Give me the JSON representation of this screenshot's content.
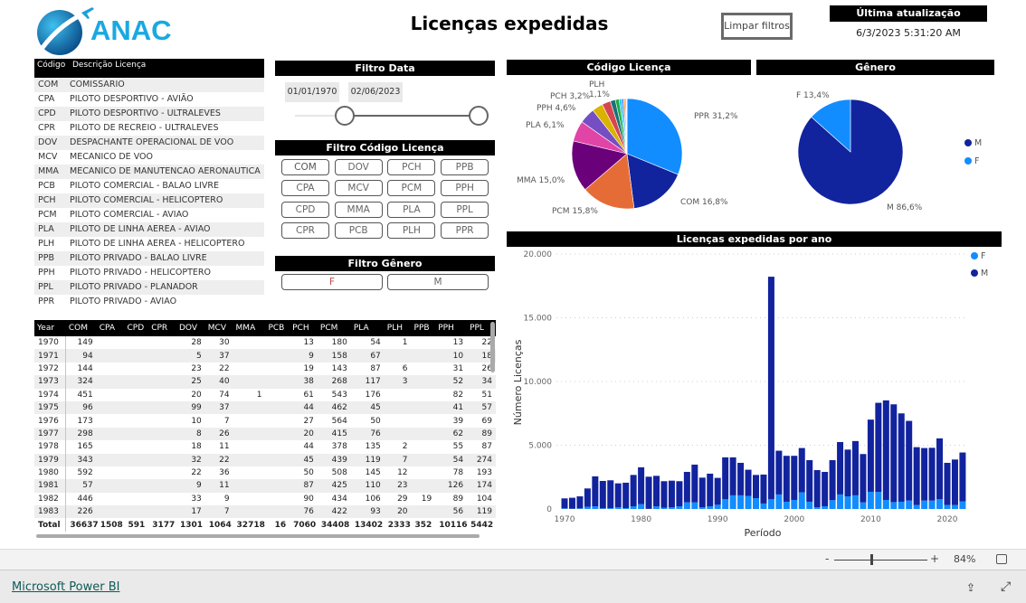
{
  "header": {
    "logo_text": "ANAC",
    "title": "Licenças expedidas",
    "clear_filters": "Limpar filtros",
    "last_update_label": "Última atualização",
    "last_update_value": "6/3/2023 5:31:20 AM"
  },
  "license_list": {
    "col_code": "Código",
    "col_desc": "Descrição Licença",
    "items": [
      [
        "COM",
        "COMISSARIO"
      ],
      [
        "CPA",
        "PILOTO DESPORTIVO - AVIÃO"
      ],
      [
        "CPD",
        "PILOTO DESPORTIVO - ULTRALEVES"
      ],
      [
        "CPR",
        "PILOTO DE RECREIO - ULTRALEVES"
      ],
      [
        "DOV",
        "DESPACHANTE OPERACIONAL DE VOO"
      ],
      [
        "MCV",
        "MECANICO DE VOO"
      ],
      [
        "MMA",
        "MECANICO DE MANUTENCAO AERONAUTICA"
      ],
      [
        "PCB",
        "PILOTO COMERCIAL - BALAO LIVRE"
      ],
      [
        "PCH",
        "PILOTO COMERCIAL - HELICOPTERO"
      ],
      [
        "PCM",
        "PILOTO COMERCIAL - AVIAO"
      ],
      [
        "PLA",
        "PILOTO DE LINHA AEREA - AVIAO"
      ],
      [
        "PLH",
        "PILOTO DE LINHA AEREA - HELICOPTERO"
      ],
      [
        "PPB",
        "PILOTO PRIVADO - BALAO LIVRE"
      ],
      [
        "PPH",
        "PILOTO PRIVADO - HELICOPTERO"
      ],
      [
        "PPL",
        "PILOTO PRIVADO - PLANADOR"
      ],
      [
        "PPR",
        "PILOTO PRIVADO - AVIAO"
      ]
    ]
  },
  "filter_date": {
    "title": "Filtro Data",
    "start": "01/01/1970",
    "end": "02/06/2023"
  },
  "filter_code": {
    "title": "Filtro Código Licença",
    "buttons": [
      "COM",
      "DOV",
      "PCH",
      "PPB",
      "CPA",
      "MCV",
      "PCM",
      "PPH",
      "CPD",
      "MMA",
      "PLA",
      "PPL",
      "CPR",
      "PCB",
      "PLH",
      "PPR"
    ]
  },
  "filter_gender": {
    "title": "Filtro Gênero",
    "buttons": [
      "F",
      "M"
    ]
  },
  "table": {
    "columns": [
      "Year",
      "COM",
      "CPA",
      "CPD",
      "CPR",
      "DOV",
      "MCV",
      "MMA",
      "PCB",
      "PCH",
      "PCM",
      "PLA",
      "PLH",
      "PPB",
      "PPH",
      "PPL"
    ],
    "rows": [
      [
        "1970",
        "149",
        "",
        "",
        "",
        "28",
        "30",
        "",
        "",
        "13",
        "180",
        "54",
        "1",
        "",
        "13",
        "22"
      ],
      [
        "1971",
        "94",
        "",
        "",
        "",
        "5",
        "37",
        "",
        "",
        "9",
        "158",
        "67",
        "",
        "",
        "10",
        "18"
      ],
      [
        "1972",
        "144",
        "",
        "",
        "",
        "23",
        "22",
        "",
        "",
        "19",
        "143",
        "87",
        "6",
        "",
        "31",
        "26"
      ],
      [
        "1973",
        "324",
        "",
        "",
        "",
        "25",
        "40",
        "",
        "",
        "38",
        "268",
        "117",
        "3",
        "",
        "52",
        "34"
      ],
      [
        "1974",
        "451",
        "",
        "",
        "",
        "20",
        "74",
        "1",
        "",
        "61",
        "543",
        "176",
        "",
        "",
        "82",
        "51"
      ],
      [
        "1975",
        "96",
        "",
        "",
        "",
        "99",
        "37",
        "",
        "",
        "44",
        "462",
        "45",
        "",
        "",
        "41",
        "57"
      ],
      [
        "1976",
        "173",
        "",
        "",
        "",
        "10",
        "7",
        "",
        "",
        "27",
        "564",
        "50",
        "",
        "",
        "39",
        "69"
      ],
      [
        "1977",
        "298",
        "",
        "",
        "",
        "8",
        "26",
        "",
        "",
        "20",
        "415",
        "76",
        "",
        "",
        "62",
        "89"
      ],
      [
        "1978",
        "165",
        "",
        "",
        "",
        "18",
        "11",
        "",
        "",
        "44",
        "378",
        "135",
        "2",
        "",
        "55",
        "87"
      ],
      [
        "1979",
        "343",
        "",
        "",
        "",
        "32",
        "22",
        "",
        "",
        "45",
        "439",
        "119",
        "7",
        "",
        "54",
        "274"
      ],
      [
        "1980",
        "592",
        "",
        "",
        "",
        "22",
        "36",
        "",
        "",
        "50",
        "508",
        "145",
        "12",
        "",
        "78",
        "193"
      ],
      [
        "1981",
        "57",
        "",
        "",
        "",
        "9",
        "11",
        "",
        "",
        "87",
        "425",
        "110",
        "23",
        "",
        "126",
        "174"
      ],
      [
        "1982",
        "446",
        "",
        "",
        "",
        "33",
        "9",
        "",
        "",
        "90",
        "434",
        "106",
        "29",
        "19",
        "89",
        "104"
      ],
      [
        "1983",
        "226",
        "",
        "",
        "",
        "17",
        "7",
        "",
        "",
        "76",
        "422",
        "93",
        "20",
        "",
        "56",
        "119"
      ]
    ],
    "total": [
      "Total",
      "36637",
      "1508",
      "591",
      "3177",
      "1301",
      "1064",
      "32718",
      "16",
      "7060",
      "34408",
      "13402",
      "2333",
      "352",
      "10116",
      "5442"
    ]
  },
  "chart_data": [
    {
      "type": "pie",
      "title": "Código Licença",
      "slices": [
        {
          "label": "PPR",
          "value": 31.2,
          "color": "#118DFF",
          "text": "PPR 31,2%"
        },
        {
          "label": "COM",
          "value": 16.8,
          "color": "#12239E",
          "text": "COM 16,8%"
        },
        {
          "label": "PCM",
          "value": 15.8,
          "color": "#E66C37",
          "text": "PCM 15,8%"
        },
        {
          "label": "MMA",
          "value": 15.0,
          "color": "#6B007B",
          "text": "MMA 15,0%"
        },
        {
          "label": "PLA",
          "value": 6.1,
          "color": "#E044A7",
          "text": "PLA 6,1%"
        },
        {
          "label": "PPH",
          "value": 4.6,
          "color": "#744EC2",
          "text": "PPH 4,6%"
        },
        {
          "label": "PCH",
          "value": 3.2,
          "color": "#D9B300",
          "text": "PCH 3,2%"
        },
        {
          "label": "PPL",
          "value": 2.5,
          "color": "#D64550"
        },
        {
          "label": "CPR",
          "value": 1.5,
          "color": "#197278"
        },
        {
          "label": "PLH",
          "value": 1.1,
          "color": "#1AAB40",
          "text": "PLH 1,1%"
        },
        {
          "label": "CPA",
          "value": 0.7,
          "color": "#15C6F4"
        },
        {
          "label": "DOV",
          "value": 0.6,
          "color": "#4092FF"
        },
        {
          "label": "MCV",
          "value": 0.5,
          "color": "#FFA058"
        },
        {
          "label": "CPD",
          "value": 0.3,
          "color": "#BE5DC9"
        },
        {
          "label": "PPB",
          "value": 0.2,
          "color": "#F472D0"
        },
        {
          "label": "PCB",
          "value": 0.01,
          "color": "#B5A1FF"
        }
      ]
    },
    {
      "type": "pie",
      "title": "Gênero",
      "slices": [
        {
          "label": "M",
          "value": 86.6,
          "color": "#12239E",
          "text": "M 86,6%"
        },
        {
          "label": "F",
          "value": 13.4,
          "color": "#118DFF",
          "text": "F 13,4%"
        }
      ],
      "legend": [
        "M",
        "F"
      ],
      "legend_position": "right"
    },
    {
      "type": "bar",
      "stacked": true,
      "title": "Licenças expedidas por ano",
      "xlabel": "Período",
      "ylabel": "Número Licenças",
      "ylim": [
        0,
        20000
      ],
      "yticks": [
        "0",
        "5.000",
        "10.000",
        "15.000",
        "20.000"
      ],
      "xticks": [
        "1970",
        "1980",
        "1990",
        "2000",
        "2010",
        "2020"
      ],
      "grid": true,
      "legend_position": "top-right",
      "x": [
        1970,
        1971,
        1972,
        1973,
        1974,
        1975,
        1976,
        1977,
        1978,
        1979,
        1980,
        1981,
        1982,
        1983,
        1984,
        1985,
        1986,
        1987,
        1988,
        1989,
        1990,
        1991,
        1992,
        1993,
        1994,
        1995,
        1996,
        1997,
        1998,
        1999,
        2000,
        2001,
        2002,
        2003,
        2004,
        2005,
        2006,
        2007,
        2008,
        2009,
        2010,
        2011,
        2012,
        2013,
        2014,
        2015,
        2016,
        2017,
        2018,
        2019,
        2020,
        2021,
        2022
      ],
      "series": [
        {
          "name": "F",
          "color": "#118DFF",
          "values": [
            50,
            20,
            50,
            170,
            210,
            50,
            70,
            140,
            70,
            210,
            380,
            10,
            210,
            100,
            140,
            210,
            520,
            520,
            140,
            210,
            330,
            760,
            1070,
            1070,
            1020,
            850,
            430,
            760,
            1140,
            570,
            710,
            1300,
            570,
            140,
            210,
            690,
            1140,
            990,
            1070,
            520,
            1350,
            1330,
            710,
            540,
            570,
            660,
            310,
            660,
            660,
            780,
            310,
            310,
            590
          ]
        },
        {
          "name": "M",
          "color": "#12239E",
          "values": [
            780,
            860,
            940,
            1440,
            2350,
            2150,
            2180,
            1870,
            1990,
            2460,
            2890,
            2520,
            2390,
            2080,
            2080,
            1970,
            2390,
            2960,
            2320,
            2560,
            2110,
            3290,
            2980,
            2550,
            2060,
            1820,
            2270,
            17460,
            3430,
            3600,
            3460,
            3480,
            3260,
            2910,
            2700,
            3140,
            4110,
            3670,
            4260,
            3790,
            5660,
            7000,
            7810,
            7670,
            6930,
            6250,
            4540,
            4120,
            4140,
            4760,
            3310,
            3570,
            3840
          ]
        }
      ]
    }
  ],
  "footer": {
    "zoom_minus": "-",
    "zoom_plus": "+",
    "zoom_value": "84%",
    "zoom_level": 84,
    "brand_link": "Microsoft Power BI"
  }
}
